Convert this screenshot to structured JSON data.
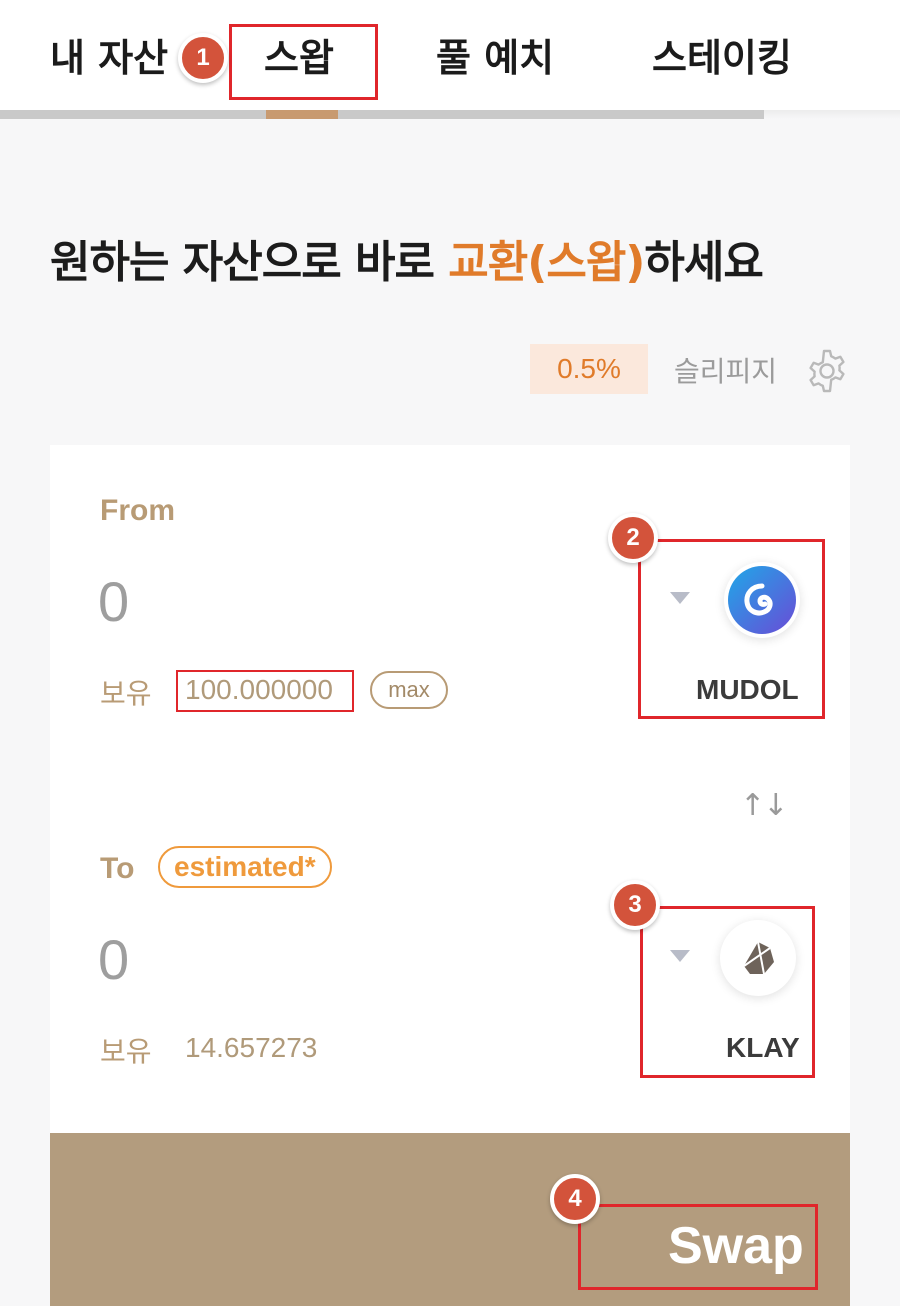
{
  "nav": {
    "tabs": [
      {
        "label": "내 자산"
      },
      {
        "label": "스왑",
        "active": true
      },
      {
        "label": "풀 예치"
      },
      {
        "label": "스테이킹"
      }
    ],
    "accent_color": "#c89a70"
  },
  "heading": {
    "prefix": "원하는 자산으로 바로 ",
    "highlight": "교환(스왑)",
    "suffix": "하세요",
    "highlight_color": "#e07b2a"
  },
  "slippage": {
    "value": "0.5%",
    "label": "슬리피지",
    "icon": "gear-icon"
  },
  "from": {
    "label": "From",
    "amount": "0",
    "holding_label": "보유",
    "holding_value": "100.000000",
    "max_label": "max",
    "token": {
      "symbol": "MUDOL",
      "icon": "mudol-token-icon"
    }
  },
  "switch_label": "↑↓",
  "to": {
    "label": "To",
    "estimated_label": "estimated*",
    "amount": "0",
    "holding_label": "보유",
    "holding_value": "14.657273",
    "token": {
      "symbol": "KLAY",
      "icon": "klay-token-icon"
    }
  },
  "swap_button": {
    "label": "Swap"
  },
  "annotations": {
    "badges": [
      "1",
      "2",
      "3",
      "4"
    ],
    "highlight_color": "#e0262b"
  }
}
